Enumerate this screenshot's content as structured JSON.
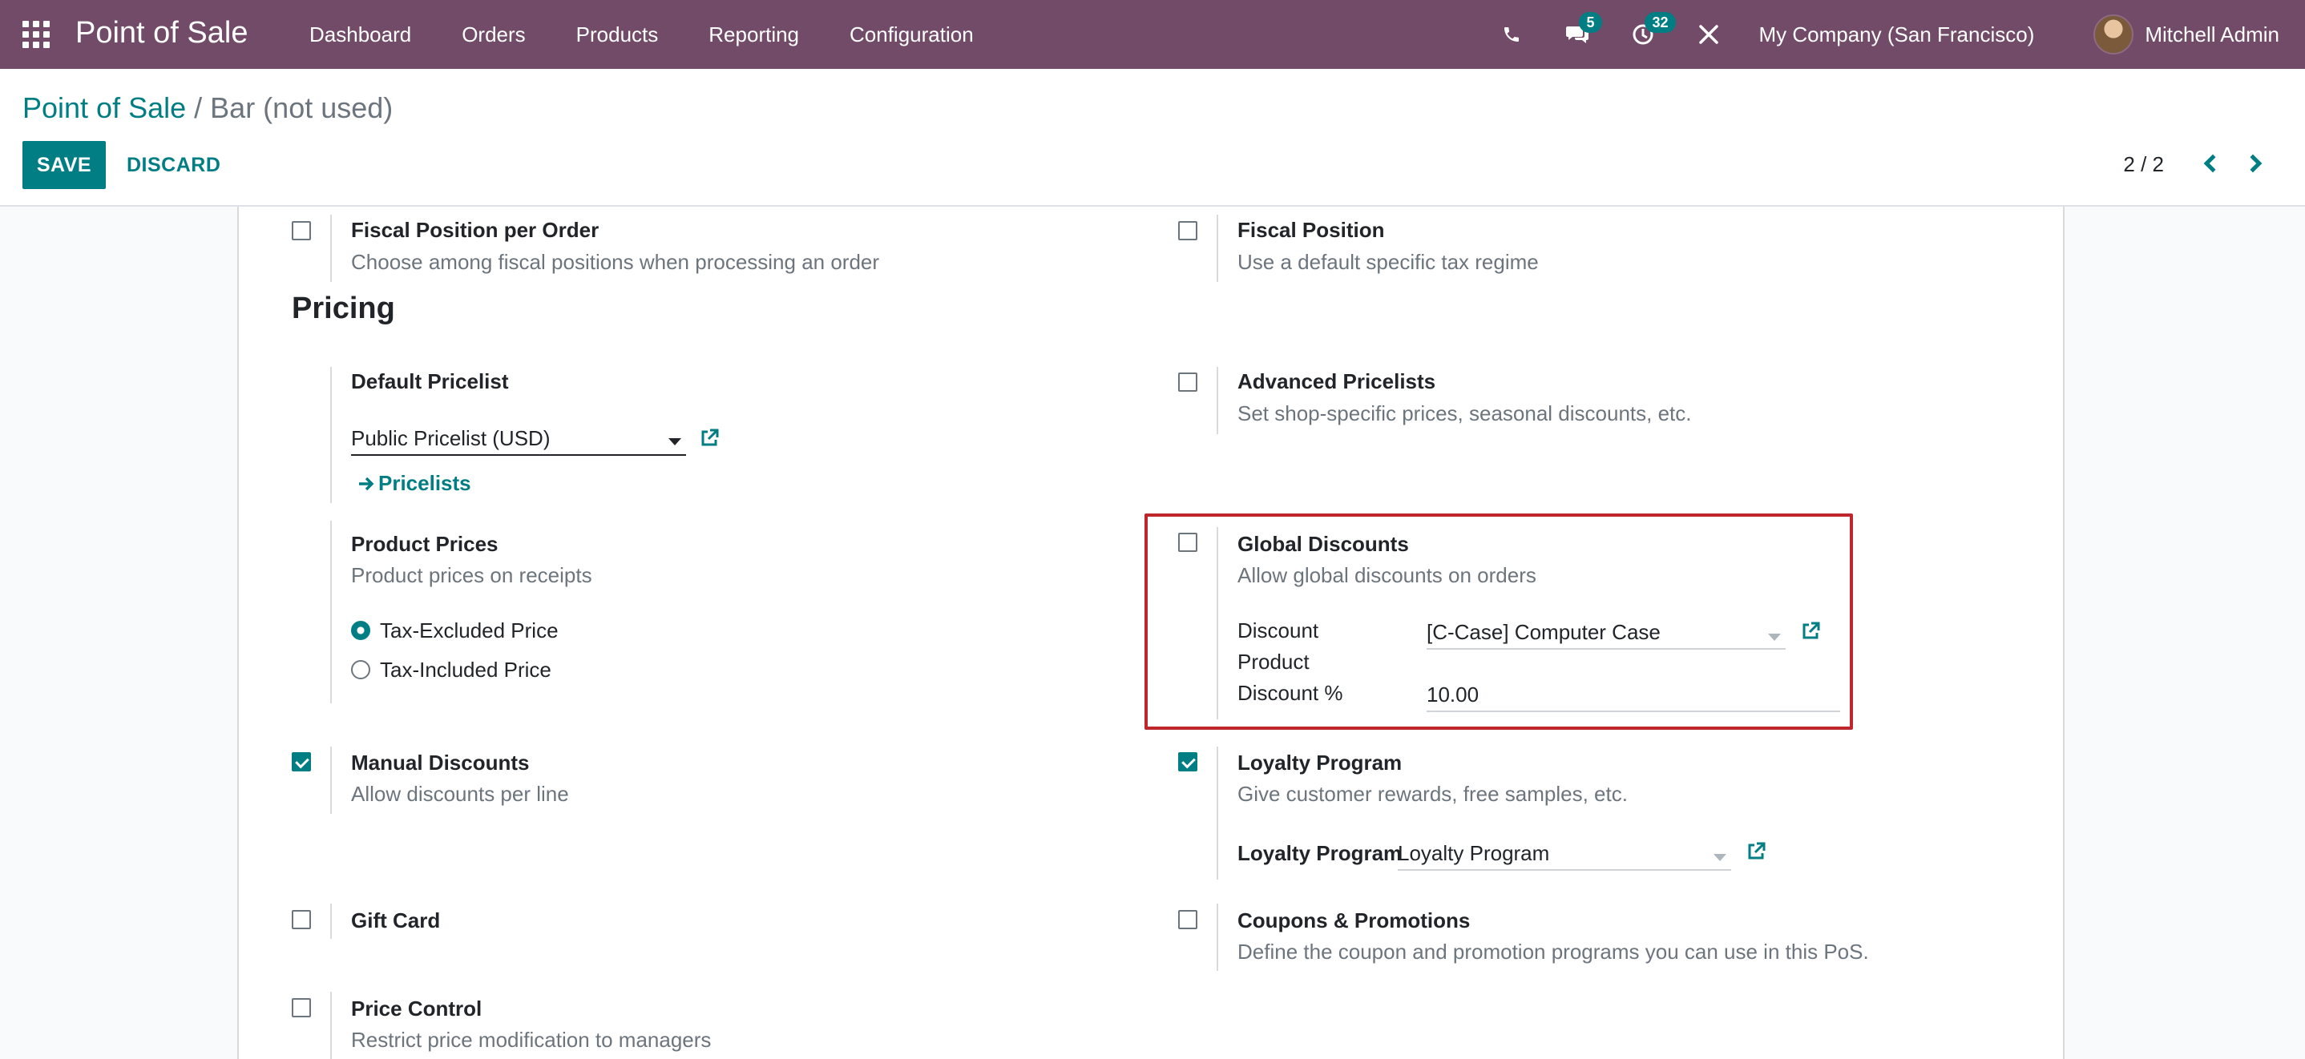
{
  "navbar": {
    "app_title": "Point of Sale",
    "menu": [
      "Dashboard",
      "Orders",
      "Products",
      "Reporting",
      "Configuration"
    ],
    "messages_count": "5",
    "activities_count": "32",
    "company": "My Company (San Francisco)",
    "user": "Mitchell Admin",
    "icons": [
      "apps-grid-icon",
      "phone-icon",
      "chat-icon",
      "clock-icon",
      "tools-icon"
    ]
  },
  "control": {
    "breadcrumb_parent": "Point of Sale",
    "breadcrumb_current": "/ Bar (not used)",
    "save_label": "SAVE",
    "discard_label": "DISCARD",
    "pager": "2 / 2"
  },
  "settings": {
    "fiscal_position_per_order": {
      "title": "Fiscal Position per Order",
      "desc": "Choose among fiscal positions when processing an order",
      "checked": false
    },
    "fiscal_position": {
      "title": "Fiscal Position",
      "desc": "Use a default specific tax regime",
      "checked": false
    },
    "pricing_heading": "Pricing",
    "default_pricelist": {
      "title": "Default Pricelist",
      "value": "Public Pricelist (USD)",
      "link": "Pricelists"
    },
    "advanced_pricelists": {
      "title": "Advanced Pricelists",
      "desc": "Set shop-specific prices, seasonal discounts, etc.",
      "checked": false
    },
    "product_prices": {
      "title": "Product Prices",
      "desc": "Product prices on receipts",
      "options": [
        "Tax-Excluded Price",
        "Tax-Included Price"
      ],
      "selected": "Tax-Excluded Price"
    },
    "global_discounts": {
      "title": "Global Discounts",
      "desc": "Allow global discounts on orders",
      "checked": false,
      "discount_product_label_1": "Discount",
      "discount_product_label_2": "Product",
      "discount_product_value": "[C-Case] Computer Case",
      "discount_pct_label": "Discount %",
      "discount_pct_value": "10.00"
    },
    "manual_discounts": {
      "title": "Manual Discounts",
      "desc": "Allow discounts per line",
      "checked": true
    },
    "loyalty_program": {
      "title": "Loyalty Program",
      "desc": "Give customer rewards, free samples, etc.",
      "checked": true,
      "field_label": "Loyalty Program",
      "field_value": "Loyalty Program"
    },
    "gift_card": {
      "title": "Gift Card",
      "checked": false
    },
    "coupons": {
      "title": "Coupons & Promotions",
      "desc": "Define the coupon and promotion programs you can use in this PoS.",
      "checked": false
    },
    "price_control": {
      "title": "Price Control",
      "desc": "Restrict price modification to managers",
      "checked": false
    }
  },
  "colors": {
    "navbar": "#714b67",
    "primary": "#017e84",
    "highlight_border": "#c0272d"
  }
}
